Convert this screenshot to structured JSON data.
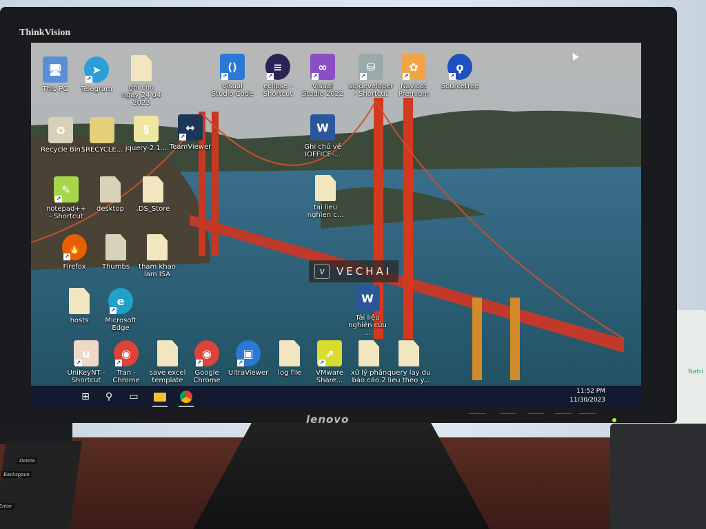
{
  "monitor": {
    "top_brand": "ThinkVision",
    "bottom_brand": "lenovo"
  },
  "watermark": "VECHAI",
  "desktop_icons": [
    {
      "label": "This PC",
      "icon": "computer-icon"
    },
    {
      "label": "Telegram",
      "icon": "telegram-icon"
    },
    {
      "label": "ghi chu ngay 24 04 2023",
      "icon": "file-icon"
    },
    {
      "label": "Visual Studio Code",
      "icon": "vscode-icon"
    },
    {
      "label": "eclipse - Shortcut",
      "icon": "eclipse-icon"
    },
    {
      "label": "Visual Studio 2022",
      "icon": "visual-studio-icon"
    },
    {
      "label": "sqldeveloper - Shortcut",
      "icon": "database-icon"
    },
    {
      "label": "Navicat Premium",
      "icon": "navicat-icon"
    },
    {
      "label": "Sourcetree",
      "icon": "sourcetree-icon"
    },
    {
      "label": "Recycle Bin",
      "icon": "recycle-bin-icon"
    },
    {
      "label": "$RECYCLE...",
      "icon": "folder-icon"
    },
    {
      "label": "jquery-2.1...",
      "icon": "script-file-icon"
    },
    {
      "label": "TeamViewer",
      "icon": "teamviewer-icon"
    },
    {
      "label": "Ghi chú về IOFFICE-...",
      "icon": "word-document-icon"
    },
    {
      "label": "notepad++ - Shortcut",
      "icon": "notepad-plus-plus-icon"
    },
    {
      "label": "desktop",
      "icon": "settings-file-icon"
    },
    {
      "label": ".DS_Store",
      "icon": "file-icon"
    },
    {
      "label": "tai lieu nghien c...",
      "icon": "file-icon"
    },
    {
      "label": "Firefox",
      "icon": "firefox-icon"
    },
    {
      "label": "Thumbs",
      "icon": "settings-file-icon"
    },
    {
      "label": "tham khao lam ISA",
      "icon": "file-icon"
    },
    {
      "label": "hosts",
      "icon": "file-icon"
    },
    {
      "label": "Microsoft Edge",
      "icon": "edge-icon"
    },
    {
      "label": "Tài liệu nghiên cứu ...",
      "icon": "word-document-icon"
    },
    {
      "label": "UniKeyNT - Shortcut",
      "icon": "unikey-icon"
    },
    {
      "label": "Tran - Chrome",
      "icon": "chrome-profile-icon"
    },
    {
      "label": "save excel template",
      "icon": "file-icon"
    },
    {
      "label": "Google Chrome",
      "icon": "chrome-icon"
    },
    {
      "label": "UltraViewer",
      "icon": "ultraviewer-icon"
    },
    {
      "label": "log file",
      "icon": "file-icon"
    },
    {
      "label": "VMware Share...",
      "icon": "vmware-share-icon"
    },
    {
      "label": "xử lý phần báo cáo 2",
      "icon": "file-icon"
    },
    {
      "label": "query lay du lieu theo y...",
      "icon": "file-icon"
    }
  ],
  "taskbar": {
    "items": [
      {
        "icon": "windows-start-icon"
      },
      {
        "icon": "search-icon"
      },
      {
        "icon": "task-view-icon"
      },
      {
        "icon": "file-explorer-icon"
      },
      {
        "icon": "chrome-profile-icon"
      }
    ],
    "time": "11:52 PM",
    "date": "11/30/2023"
  },
  "keyboard_keys": [
    "Delete",
    "Backspace",
    "Enter"
  ]
}
